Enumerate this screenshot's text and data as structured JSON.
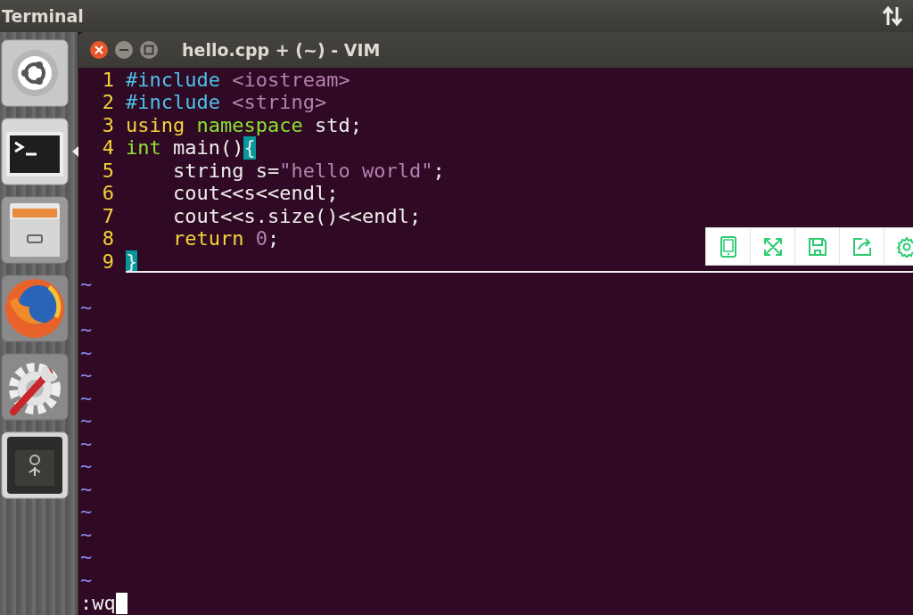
{
  "top_bar": {
    "title": "Terminal"
  },
  "launcher": [
    {
      "kind": "ubuntu",
      "running": false
    },
    {
      "kind": "terminal",
      "running": true
    },
    {
      "kind": "files",
      "running": false
    },
    {
      "kind": "firefox",
      "running": false
    },
    {
      "kind": "settings",
      "running": false
    },
    {
      "kind": "safe",
      "running": false
    }
  ],
  "window": {
    "title": "hello.cpp + (~) - VIM"
  },
  "lines": [
    {
      "number": "1",
      "cursorline": false,
      "tokens": [
        {
          "text": "#include",
          "kind": "preproc"
        },
        {
          "text": " <iostream>",
          "kind": "string"
        }
      ]
    },
    {
      "number": "2",
      "cursorline": false,
      "tokens": [
        {
          "text": "#include",
          "kind": "preproc"
        },
        {
          "text": " <string>",
          "kind": "string"
        }
      ]
    },
    {
      "number": "3",
      "cursorline": false,
      "tokens": [
        {
          "text": "using",
          "kind": "statement"
        },
        {
          "text": " namespace",
          "kind": "type"
        },
        {
          "text": " std;",
          "kind": "normal"
        }
      ]
    },
    {
      "number": "4",
      "cursorline": false,
      "tokens": [
        {
          "text": "int",
          "kind": "type"
        },
        {
          "text": " main()",
          "kind": "normal"
        },
        {
          "text": "{",
          "kind": "match"
        }
      ]
    },
    {
      "number": "5",
      "cursorline": false,
      "tokens": [
        {
          "text": "    string s=",
          "kind": "normal"
        },
        {
          "text": "\"hello world\"",
          "kind": "string"
        },
        {
          "text": ";",
          "kind": "normal"
        }
      ]
    },
    {
      "number": "6",
      "cursorline": false,
      "tokens": [
        {
          "text": "    cout<<s<<endl;",
          "kind": "normal"
        }
      ]
    },
    {
      "number": "7",
      "cursorline": false,
      "tokens": [
        {
          "text": "    cout<<s.size()<<endl;",
          "kind": "normal"
        }
      ]
    },
    {
      "number": "8",
      "cursorline": false,
      "tokens": [
        {
          "text": "    return",
          "kind": "statement"
        },
        {
          "text": " 0",
          "kind": "string"
        },
        {
          "text": ";",
          "kind": "normal"
        }
      ]
    },
    {
      "number": "9",
      "cursorline": true,
      "tokens": [
        {
          "text": "}",
          "kind": "match"
        }
      ]
    }
  ],
  "empty_lines": [
    "~",
    "~",
    "~",
    "~",
    "~",
    "~",
    "~",
    "~",
    "~",
    "~",
    "~",
    "~",
    "~",
    "~"
  ],
  "command_line": ":wq",
  "float_toolbar": [
    {
      "kind": "tablet"
    },
    {
      "kind": "fullscreen"
    },
    {
      "kind": "save"
    },
    {
      "kind": "share"
    },
    {
      "kind": "settings"
    }
  ]
}
